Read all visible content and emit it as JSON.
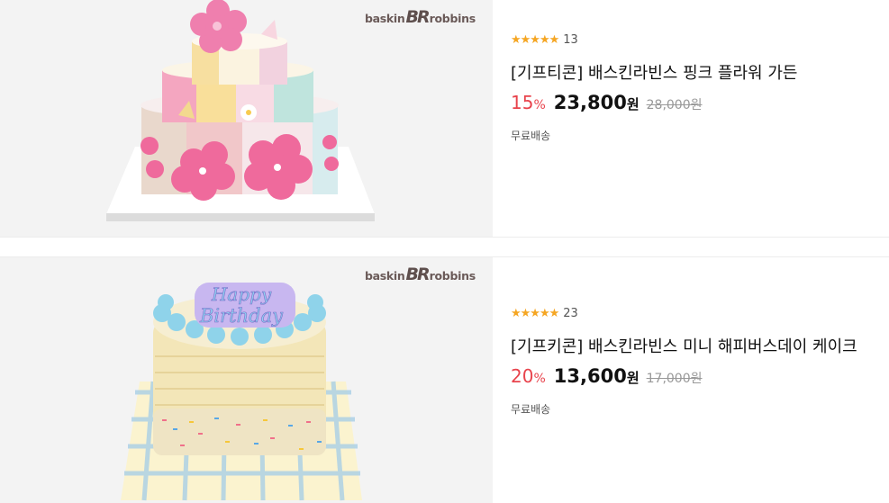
{
  "products": [
    {
      "brand_logo": "baskin BR robbins",
      "rating_stars": "★★★★★",
      "rating_value": 4.5,
      "review_count": "13",
      "title": "[기프티콘] 배스킨라빈스 핑크 플라워 가든",
      "discount": "15",
      "discount_unit": "%",
      "price": "23,800",
      "price_unit": "원",
      "original_price": "28,000원",
      "shipping": "무료배송"
    },
    {
      "brand_logo": "baskin BR robbins",
      "rating_stars": "★★★★★",
      "rating_value": 4.5,
      "review_count": "23",
      "title": "[기프키콘] 배스킨라빈스 미니 해피버스데이 케이크",
      "discount": "20",
      "discount_unit": "%",
      "price": "13,600",
      "price_unit": "원",
      "original_price": "17,000원",
      "shipping": "무료배송",
      "cake_topper": "Happy Birthday"
    }
  ],
  "colors": {
    "discount": "#e8434c",
    "star": "#f5a623",
    "thumb_bg": "#f3f3f3"
  }
}
